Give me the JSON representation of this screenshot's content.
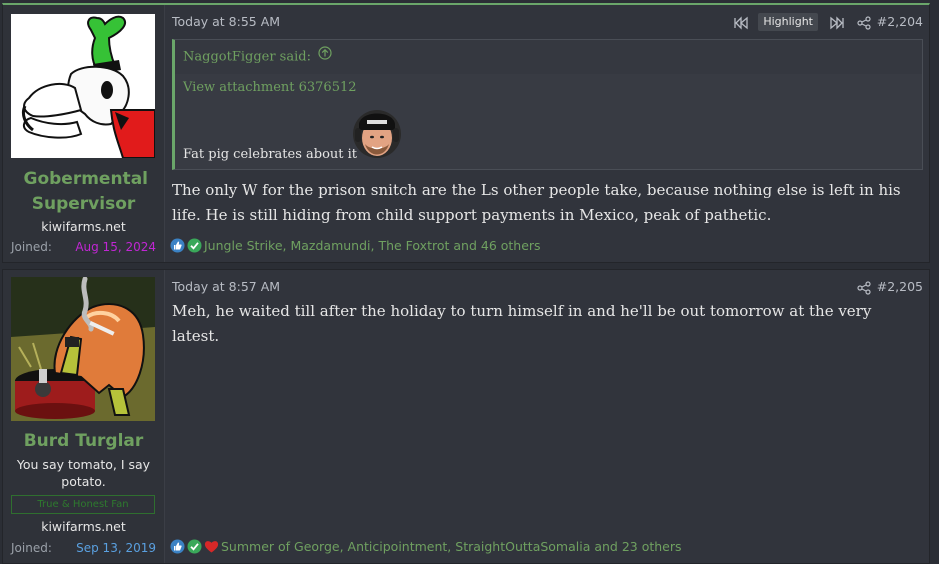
{
  "posts": [
    {
      "user": {
        "name": "Gobermental Supervisor",
        "site": "kiwifarms.net",
        "joined_label": "Joined:",
        "joined_date": "Aug 15, 2024",
        "joined_color": "#c026d3"
      },
      "timestamp": "Today at 8:55 AM",
      "highlight_label": "Highlight",
      "post_number": "#2,204",
      "quote": {
        "author": "NaggotFigger said:",
        "attachment": "View attachment 6376512",
        "text": "Fat pig celebrates about it"
      },
      "message": "The only W for the prison snitch are the Ls other people take, because nothing else is left in his life. He is still hiding from child support payments in Mexico, peak of pathetic.",
      "reactions": "Jungle Strike, Mazdamundi, The Foxtrot and 46 others"
    },
    {
      "user": {
        "name": "Burd Turglar",
        "title": "You say tomato, I say potato.",
        "banner": "True & Honest Fan",
        "site": "kiwifarms.net",
        "joined_label": "Joined:",
        "joined_date": "Sep 13, 2019",
        "joined_color": "#5aa0e0"
      },
      "timestamp": "Today at 8:57 AM",
      "post_number": "#2,205",
      "message": "Meh, he waited till after the holiday to turn himself in and he'll be out tomorrow at the very latest.",
      "reactions": "Summer of George, Anticipointment, StraightOuttaSomalia and 23 others"
    }
  ],
  "icons": {
    "share": "share-icon",
    "prev": "rewind-icon",
    "next": "fast-forward-icon",
    "quote_up": "arrow-up-circle-icon",
    "reactions": [
      "like-icon",
      "check-icon",
      "heart-icon"
    ]
  },
  "colors": {
    "accent": "#6fa060",
    "background": "#2b2e35",
    "post_bg": "#31343c"
  }
}
